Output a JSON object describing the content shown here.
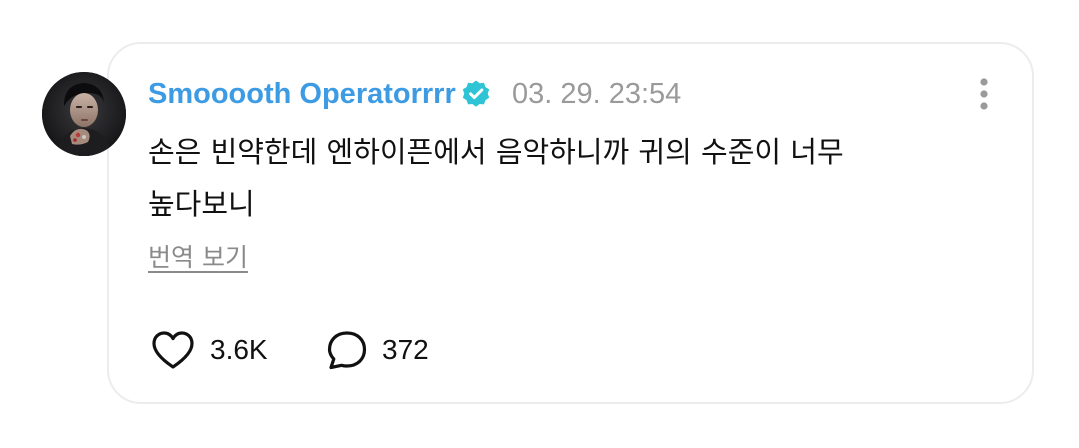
{
  "comment": {
    "author": "Smooooth Operatorrrr",
    "verified": true,
    "timestamp": "03. 29. 23:54",
    "text": "손은 빈약한데 엔하이픈에서 음악하니까 귀의 수준이 너무\n높다보니",
    "translate_label": "번역 보기",
    "likes": "3.6K",
    "replies": "372"
  },
  "icons": {
    "verified": "verified-badge-icon",
    "more": "more-vertical-icon",
    "like": "heart-outline-icon",
    "reply": "speech-bubble-icon"
  },
  "colors": {
    "author": "#3d9be4",
    "verified_badge": "#2ec4d6",
    "timestamp": "#9a9a9a",
    "text": "#111111",
    "card_border": "#ececec"
  }
}
